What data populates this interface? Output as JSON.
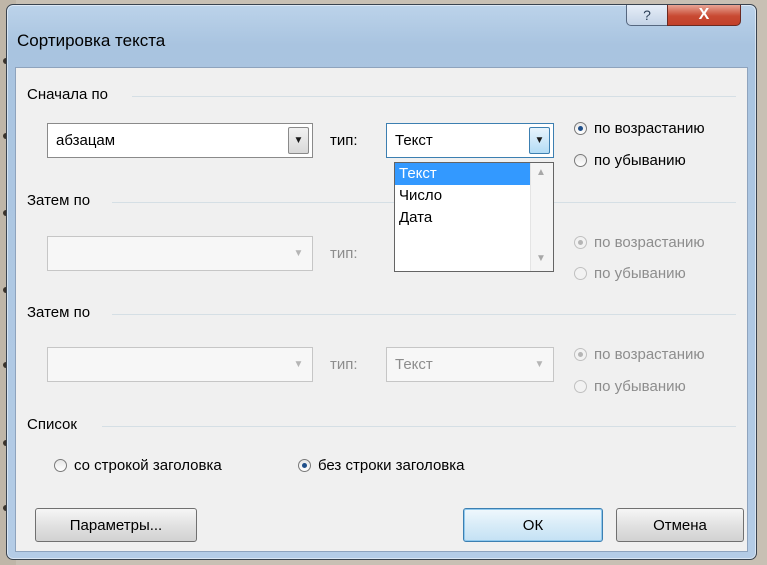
{
  "dialog": {
    "title": "Сортировка текста",
    "help_label": "?",
    "close_label": "X"
  },
  "sort1": {
    "group_label": "Сначала по",
    "field_value": "абзацам",
    "type_label": "тип:",
    "type_value": "Текст",
    "ascending_label": "по возрастанию",
    "descending_label": "по убыванию",
    "selected_order": "ascending"
  },
  "type_dropdown": {
    "options": [
      "Текст",
      "Число",
      "Дата"
    ],
    "highlighted": "Текст"
  },
  "sort2": {
    "group_label": "Затем по",
    "field_value": "",
    "type_label": "тип:",
    "ascending_label": "по возрастанию",
    "descending_label": "по убыванию",
    "enabled": false
  },
  "sort3": {
    "group_label": "Затем по",
    "field_value": "",
    "type_label": "тип:",
    "type_value": "Текст",
    "ascending_label": "по возрастанию",
    "descending_label": "по убыванию",
    "enabled": false
  },
  "list": {
    "group_label": "Список",
    "with_header_label": "со строкой заголовка",
    "without_header_label": "без строки заголовка",
    "selected": "without_header"
  },
  "buttons": {
    "options_label": "Параметры...",
    "ok_label": "ОК",
    "cancel_label": "Отмена"
  },
  "colors": {
    "window_frame": "#a9c4e0",
    "close_button": "#c84a33",
    "selection": "#3399ff"
  }
}
